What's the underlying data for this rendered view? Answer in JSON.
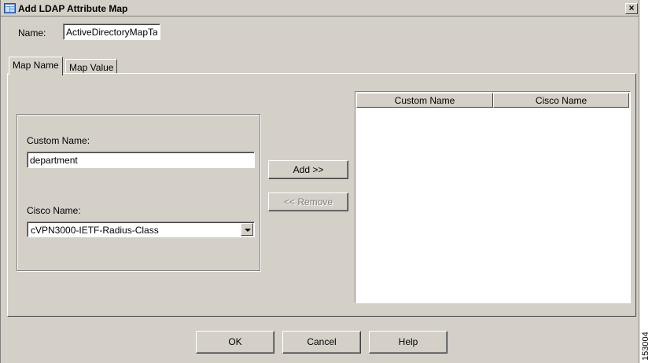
{
  "window": {
    "title": "Add LDAP Attribute Map",
    "close_glyph": "×",
    "icon": "window-app-icon"
  },
  "name_field": {
    "label": "Name:",
    "value": "ActiveDirectoryMapTa"
  },
  "tabs": [
    {
      "label": "Map Name",
      "active": true
    },
    {
      "label": "Map Value",
      "active": false
    }
  ],
  "map_name": {
    "custom_name_label": "Custom Name:",
    "custom_name_value": "department",
    "cisco_name_label": "Cisco Name:",
    "cisco_name_value": "cVPN3000-IETF-Radius-Class",
    "add_button": "Add >>",
    "remove_button": "<< Remove",
    "remove_enabled": false
  },
  "table": {
    "columns": [
      "Custom Name",
      "Cisco Name"
    ],
    "rows": []
  },
  "footer": {
    "ok": "OK",
    "cancel": "Cancel",
    "help": "Help"
  },
  "figure_number": "153004",
  "colors": {
    "dialog_bg": "#d4d0c8",
    "shadow": "#808080",
    "highlight": "#ffffff"
  }
}
